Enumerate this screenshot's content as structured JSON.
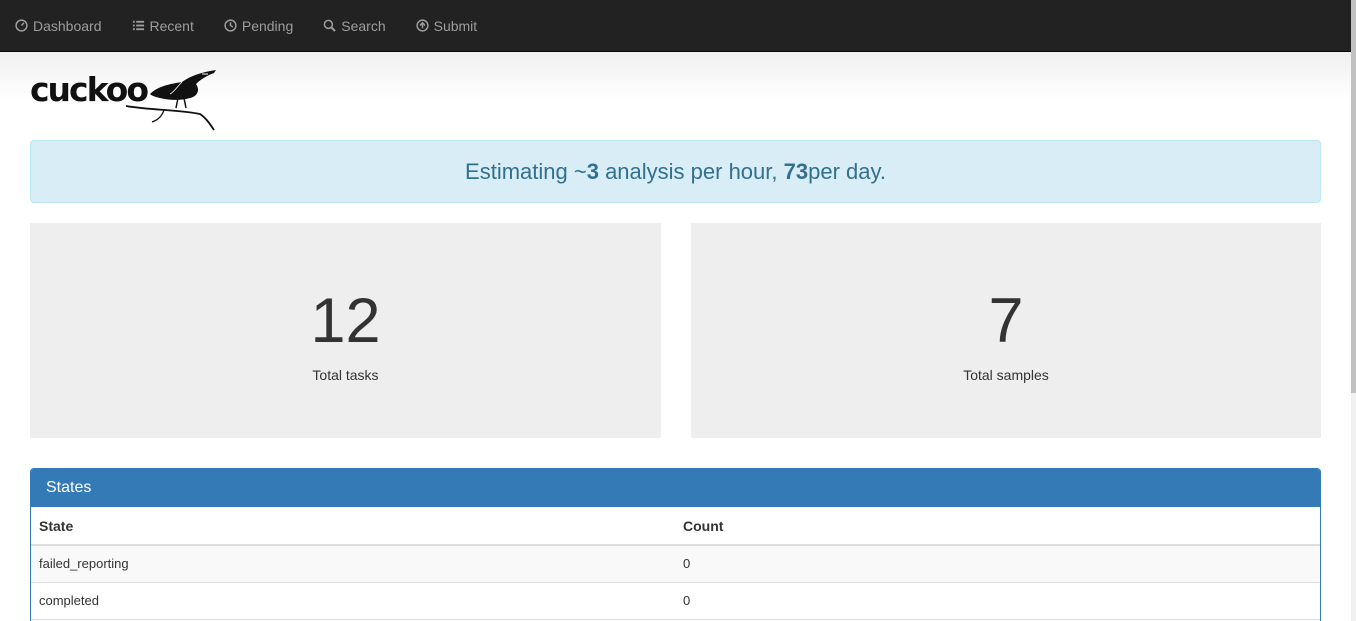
{
  "nav": {
    "items": [
      {
        "label": "Dashboard",
        "icon": "dashboard-icon"
      },
      {
        "label": "Recent",
        "icon": "list-icon"
      },
      {
        "label": "Pending",
        "icon": "clock-icon"
      },
      {
        "label": "Search",
        "icon": "search-icon"
      },
      {
        "label": "Submit",
        "icon": "upload-icon"
      }
    ]
  },
  "brand": {
    "logo_text": "cuckoo"
  },
  "estimate": {
    "prefix": "Estimating ~",
    "per_hour": "3",
    "middle": " analysis per hour, ",
    "per_day": "73",
    "suffix": " per day."
  },
  "stats": {
    "tasks": {
      "value": "12",
      "label": "Total tasks"
    },
    "samples": {
      "value": "7",
      "label": "Total samples"
    }
  },
  "states_panel": {
    "title": "States",
    "headers": [
      "State",
      "Count"
    ],
    "rows": [
      {
        "state": "failed_reporting",
        "count": "0"
      },
      {
        "state": "completed",
        "count": "0"
      }
    ]
  },
  "colors": {
    "navbar": "#222222",
    "primary": "#337ab7",
    "alert_bg": "#d9edf7",
    "alert_text": "#31708f"
  }
}
